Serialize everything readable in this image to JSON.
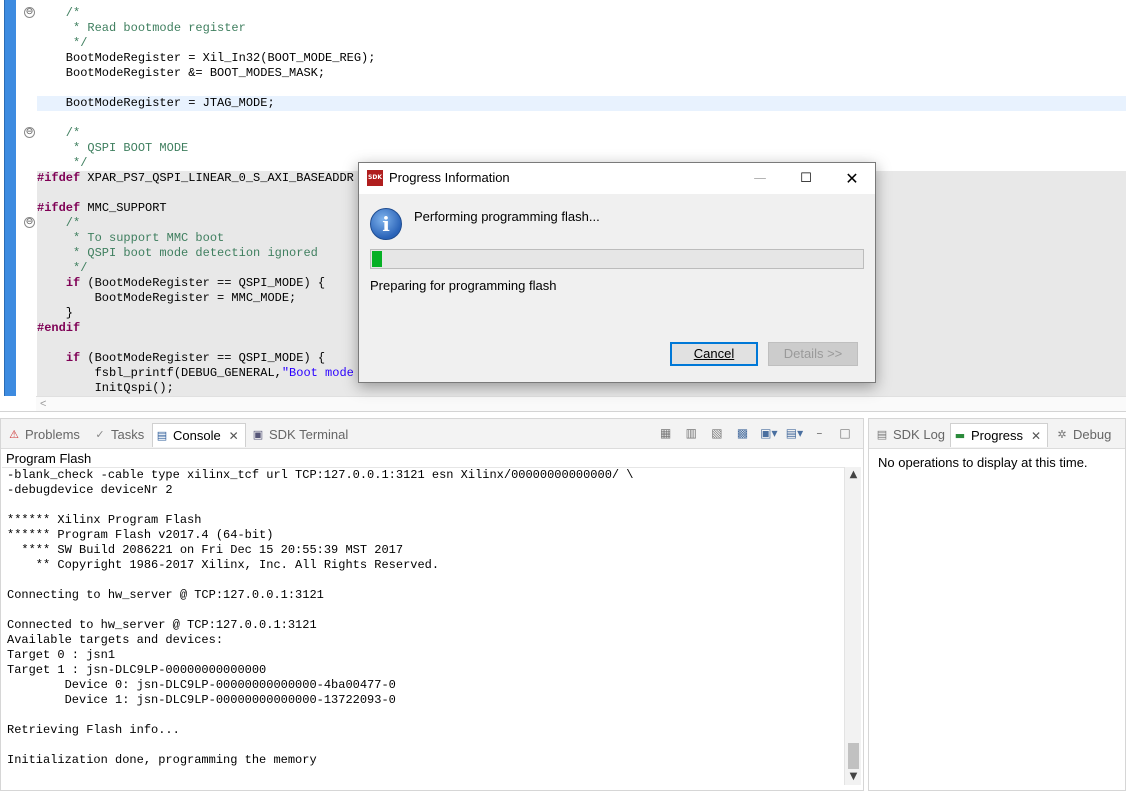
{
  "editor": {
    "lines": [
      {
        "text": "    /*",
        "style": "comment"
      },
      {
        "text": "     * Read bootmode register",
        "style": "comment"
      },
      {
        "text": "     */",
        "style": "comment"
      },
      {
        "text": "    BootModeRegister = Xil_In32(BOOT_MODE_REG);",
        "style": "code"
      },
      {
        "text": "    BootModeRegister &= BOOT_MODES_MASK;",
        "style": "code"
      },
      {
        "text": "",
        "style": "code"
      },
      {
        "text": "    BootModeRegister = JTAG_MODE;",
        "style": "code"
      },
      {
        "text": "",
        "style": "code"
      },
      {
        "text": "    /*",
        "style": "comment"
      },
      {
        "text": "     * QSPI BOOT MODE",
        "style": "comment"
      },
      {
        "text": "     */",
        "style": "comment"
      },
      {
        "text": "#ifdef XPAR_PS7_QSPI_LINEAR_0_S_AXI_BASEADDR",
        "style": "pre"
      },
      {
        "text": "",
        "style": "code"
      },
      {
        "text": "#ifdef MMC_SUPPORT",
        "style": "pre"
      },
      {
        "text": "    /*",
        "style": "comment"
      },
      {
        "text": "     * To support MMC boot",
        "style": "comment"
      },
      {
        "text": "     * QSPI boot mode detection ignored",
        "style": "comment"
      },
      {
        "text": "     */",
        "style": "comment"
      },
      {
        "text": "    if (BootModeRegister == QSPI_MODE) {",
        "style": "code"
      },
      {
        "text": "        BootModeRegister = MMC_MODE;",
        "style": "code"
      },
      {
        "text": "    }",
        "style": "code"
      },
      {
        "text": "#endif",
        "style": "pre"
      },
      {
        "text": "",
        "style": "code"
      },
      {
        "text": "    if (BootModeRegister == QSPI_MODE) {",
        "style": "code"
      },
      {
        "text": "        fsbl_printf(DEBUG_GENERAL,\"Boot mode i",
        "style": "code"
      },
      {
        "text": "        InitQspi();",
        "style": "code"
      }
    ]
  },
  "bottom_tabs": {
    "problems": "Problems",
    "tasks": "Tasks",
    "console": "Console",
    "sdk_terminal": "SDK Terminal"
  },
  "console": {
    "name": "Program Flash",
    "lines": [
      "-blank_check -cable type xilinx_tcf url TCP:127.0.0.1:3121 esn Xilinx/00000000000000/ \\",
      "-debugdevice deviceNr 2",
      "",
      "****** Xilinx Program Flash",
      "****** Program Flash v2017.4 (64-bit)",
      "  **** SW Build 2086221 on Fri Dec 15 20:55:39 MST 2017",
      "    ** Copyright 1986-2017 Xilinx, Inc. All Rights Reserved.",
      "",
      "Connecting to hw_server @ TCP:127.0.0.1:3121",
      "",
      "Connected to hw_server @ TCP:127.0.0.1:3121",
      "Available targets and devices:",
      "Target 0 : jsn1",
      "Target 1 : jsn-DLC9LP-00000000000000",
      "        Device 0: jsn-DLC9LP-00000000000000-4ba00477-0",
      "        Device 1: jsn-DLC9LP-00000000000000-13722093-0",
      "",
      "Retrieving Flash info...",
      "",
      "Initialization done, programming the memory"
    ]
  },
  "right_tabs": {
    "sdk_log": "SDK Log",
    "progress": "Progress",
    "debug": "Debug"
  },
  "progress_view": {
    "empty_message": "No operations to display at this time."
  },
  "dialog": {
    "title": "Progress Information",
    "icon_text": "SDK",
    "message": "Performing programming flash...",
    "subtask": "Preparing for programming flash",
    "progress_fraction": 0.02,
    "progress_color": "#06b025",
    "cancel_label": "Cancel",
    "details_label": "Details >>"
  }
}
